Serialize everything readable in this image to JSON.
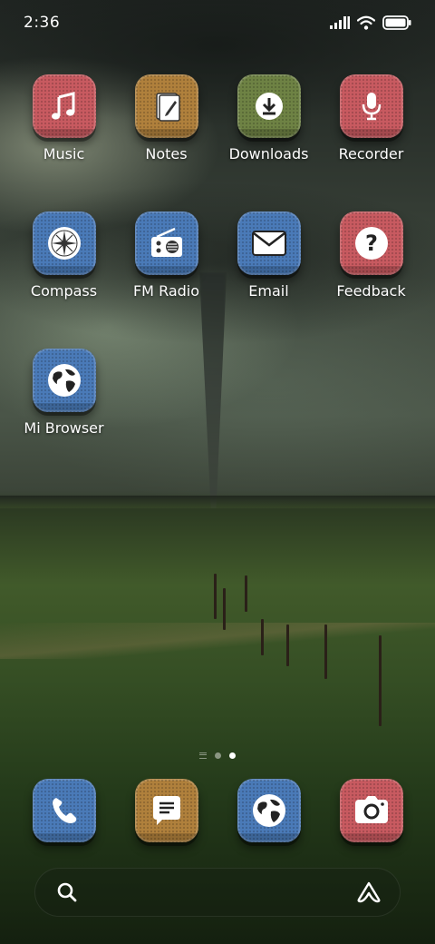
{
  "status_bar": {
    "time": "2:36",
    "icons": [
      "signal-icon",
      "wifi-icon",
      "battery-icon"
    ]
  },
  "apps": [
    {
      "label": "Music",
      "icon": "music-note-icon",
      "color": "#c85a60"
    },
    {
      "label": "Notes",
      "icon": "notes-icon",
      "color": "#b0803c"
    },
    {
      "label": "Downloads",
      "icon": "download-icon",
      "color": "#6e8244"
    },
    {
      "label": "Recorder",
      "icon": "microphone-icon",
      "color": "#c85a60"
    },
    {
      "label": "Compass",
      "icon": "compass-icon",
      "color": "#4a7ab8"
    },
    {
      "label": "FM Radio",
      "icon": "radio-icon",
      "color": "#4a7ab8"
    },
    {
      "label": "Email",
      "icon": "envelope-icon",
      "color": "#4a7ab8"
    },
    {
      "label": "Feedback",
      "icon": "question-icon",
      "color": "#c85a60"
    },
    {
      "label": "Mi Browser",
      "icon": "globe-icon",
      "color": "#4a7ab8"
    }
  ],
  "page_indicator": {
    "pages": 2,
    "current": 2
  },
  "dock": [
    {
      "icon": "phone-icon",
      "color": "#4a7ab8"
    },
    {
      "icon": "message-icon",
      "color": "#b0803c"
    },
    {
      "icon": "globe-icon",
      "color": "#4a7ab8"
    },
    {
      "icon": "camera-icon",
      "color": "#c85a60"
    }
  ],
  "search_bar": {
    "left_icon": "search-icon",
    "right_icon": "assistant-icon"
  }
}
